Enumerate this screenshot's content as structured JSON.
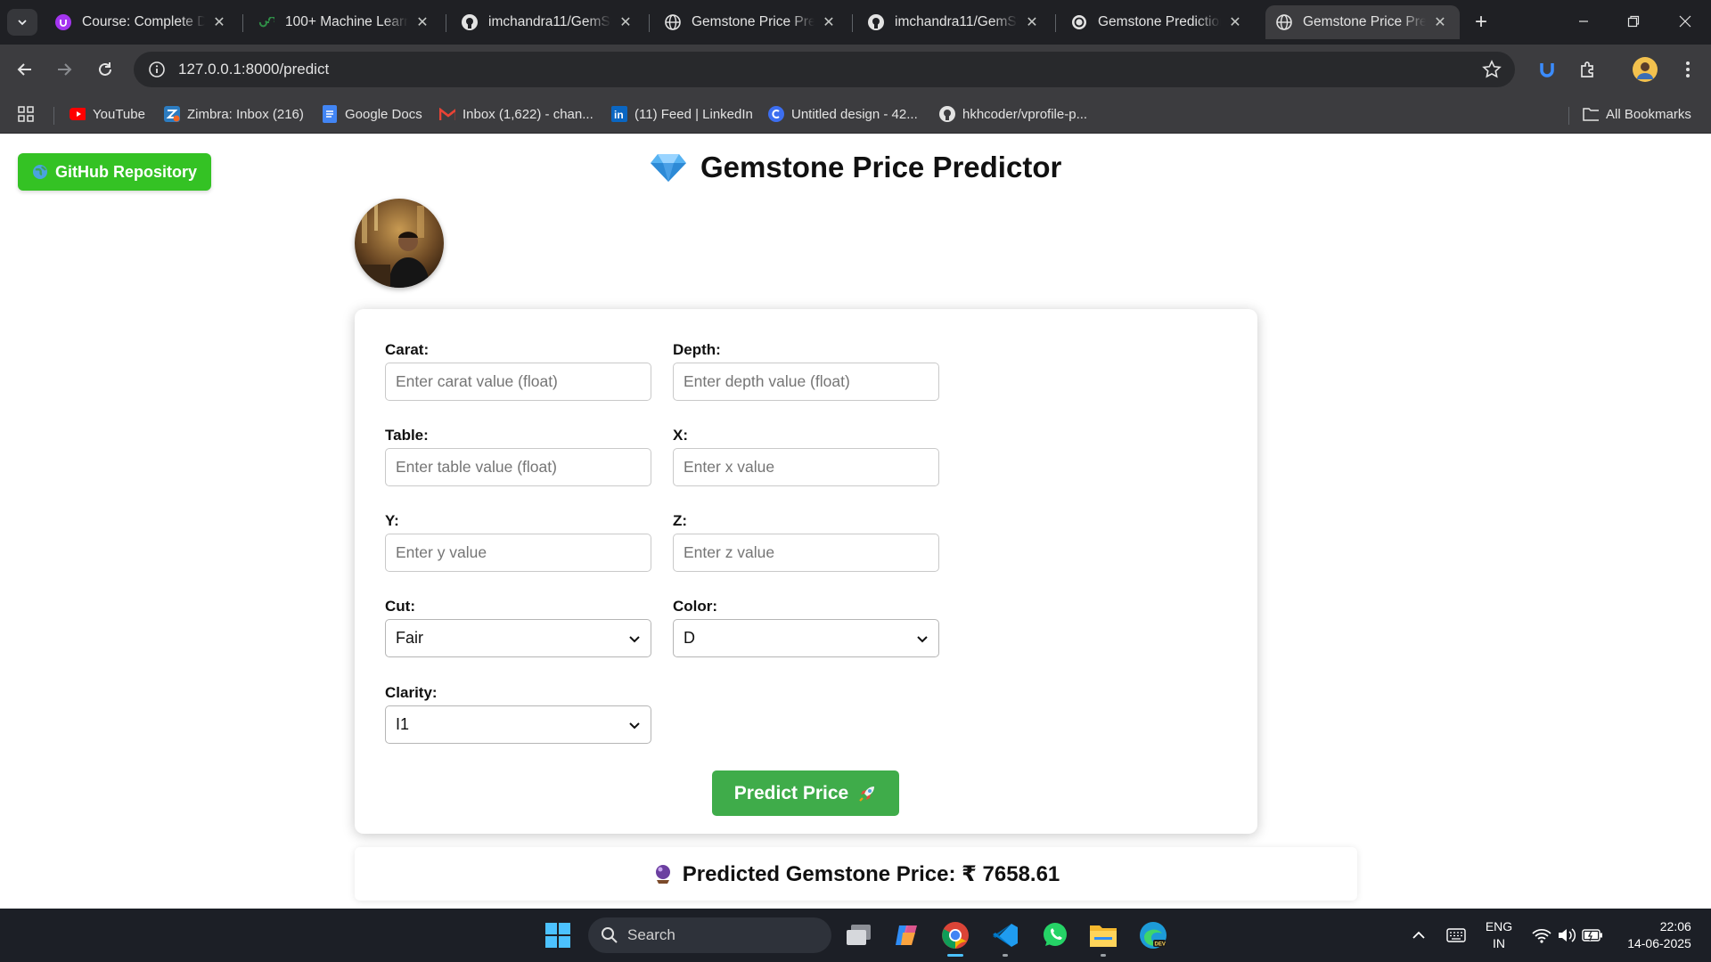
{
  "browser": {
    "tabs": [
      {
        "title": "Course: Complete Da",
        "icon": "udemy-icon",
        "active": false
      },
      {
        "title": "100+ Machine Learni",
        "icon": "geeksforgeeks-icon",
        "active": false
      },
      {
        "title": "imchandra11/GemSt",
        "icon": "github-icon",
        "active": false
      },
      {
        "title": "Gemstone Price Pred",
        "icon": "globe-icon",
        "active": false
      },
      {
        "title": "imchandra11/GemSt",
        "icon": "github-icon",
        "active": false
      },
      {
        "title": "Gemstone Prediction",
        "icon": "chatgpt-icon",
        "active": false
      },
      {
        "title": "Gemstone Price Pred",
        "icon": "globe-icon",
        "active": true
      }
    ],
    "address_bar": {
      "url": "127.0.0.1:8000/predict"
    },
    "bookmarks": [
      {
        "label": "YouTube",
        "icon": "youtube-icon"
      },
      {
        "label": "Zimbra: Inbox (216)",
        "icon": "zimbra-icon"
      },
      {
        "label": "Google Docs",
        "icon": "google-docs-icon"
      },
      {
        "label": "Inbox (1,622) - chan...",
        "icon": "gmail-icon"
      },
      {
        "label": "(11) Feed | LinkedIn",
        "icon": "linkedin-icon"
      },
      {
        "label": "Untitled design - 42...",
        "icon": "canva-icon"
      },
      {
        "label": "hkhcoder/vprofile-p...",
        "icon": "github-icon"
      }
    ],
    "all_bookmarks_label": "All Bookmarks"
  },
  "page": {
    "github_button_label": "GitHub Repository",
    "title": "Gemstone Price Predictor",
    "form": {
      "carat": {
        "label": "Carat:",
        "placeholder": "Enter carat value (float)"
      },
      "depth": {
        "label": "Depth:",
        "placeholder": "Enter depth value (float)"
      },
      "table": {
        "label": "Table:",
        "placeholder": "Enter table value (float)"
      },
      "x": {
        "label": "X:",
        "placeholder": "Enter x value"
      },
      "y": {
        "label": "Y:",
        "placeholder": "Enter y value"
      },
      "z": {
        "label": "Z:",
        "placeholder": "Enter z value"
      },
      "cut": {
        "label": "Cut:",
        "selected": "Fair"
      },
      "color": {
        "label": "Color:",
        "selected": "D"
      },
      "clarity": {
        "label": "Clarity:",
        "selected": "I1"
      },
      "submit_label": "Predict Price"
    },
    "result_text": "Predicted Gemstone Price: ₹ 7658.61"
  },
  "taskbar": {
    "search_label": "Search",
    "language": {
      "line1": "ENG",
      "line2": "IN"
    },
    "clock": {
      "time": "22:06",
      "date": "14-06-2025"
    }
  },
  "colors": {
    "github_button": "#34c224",
    "predict_button": "#3fac4a",
    "chrome_dark": "#1f2024",
    "chrome_toolbar": "#3c3c3f"
  }
}
